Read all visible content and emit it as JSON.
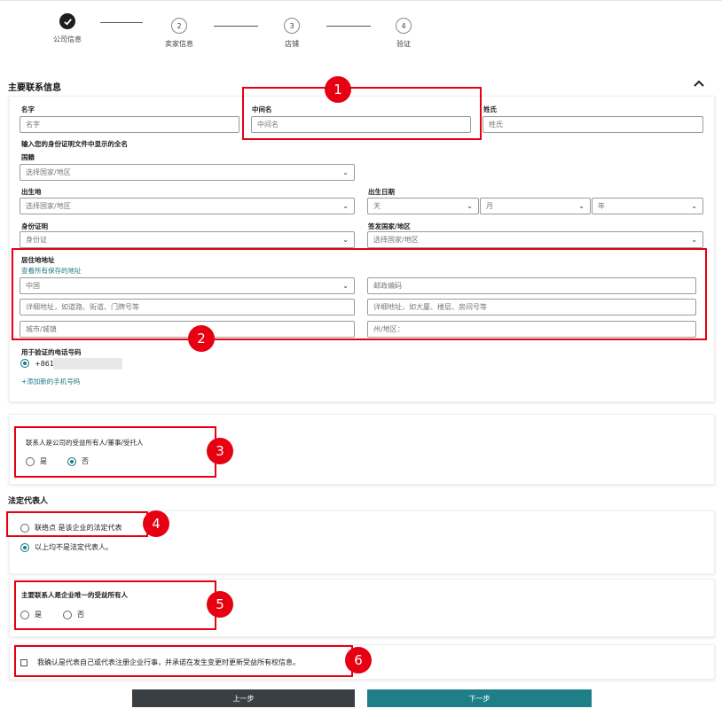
{
  "stepper": [
    {
      "num": "",
      "label": "公司信息",
      "done": true
    },
    {
      "num": "2",
      "label": "卖家信息",
      "done": false
    },
    {
      "num": "3",
      "label": "店铺",
      "done": false
    },
    {
      "num": "4",
      "label": "验证",
      "done": false
    }
  ],
  "primary_contact": {
    "title": "主要联系信息",
    "first_name": {
      "label": "名字",
      "placeholder": "名字"
    },
    "middle_name": {
      "label": "中间名",
      "placeholder": "中间名"
    },
    "last_name": {
      "label": "姓氏",
      "placeholder": "姓氏"
    },
    "fullname_hint": "输入您的身份证明文件中显示的全名",
    "nationality": {
      "label": "国籍",
      "value": "选择国家/地区"
    },
    "birthplace": {
      "label": "出生地",
      "value": "选择国家/地区"
    },
    "birthdate": {
      "label": "出生日期",
      "day": "天",
      "month": "月",
      "year": "年"
    },
    "id_proof": {
      "label": "身份证明",
      "value": "身份证"
    },
    "issuing_country": {
      "label": "签发国家/地区",
      "value": "选择国家/地区"
    },
    "address": {
      "label": "居住地地址",
      "saved_link": "查看所有保存的地址",
      "country": "中国",
      "postcode": "邮政编码",
      "line1": "详细地址，如道路、街道、门牌号等",
      "line2": "详细地址，如大厦、楼层、房间号等",
      "city": "城市/城镇",
      "state": "州/地区："
    },
    "phone": {
      "label": "用于验证的电话号码",
      "number": "+861",
      "add_link": "+添加新的手机号码"
    }
  },
  "beneficial_owner": {
    "question": "联系人是公司的受益所有人/董事/受托人",
    "yes": "是",
    "no": "否"
  },
  "legal_rep": {
    "title": "法定代表人",
    "option1": "联络点 是该企业的法定代表",
    "option2": "以上均不是法定代表人。"
  },
  "sole_owner": {
    "question": "主要联系人是企业唯一的受益所有人",
    "yes": "是",
    "no": "否"
  },
  "confirm": {
    "text": "我确认是代表自己或代表注册企业行事，并承诺在发生变更时更新受益所有权信息。"
  },
  "buttons": {
    "prev": "上一步",
    "next": "下一步"
  },
  "badges": [
    "1",
    "2",
    "3",
    "4",
    "5",
    "6"
  ],
  "colors": {
    "accent": "#1a7a83",
    "highlight": "#e60012",
    "prev_btn": "#3a3f44",
    "next_btn": "#1f7f88"
  }
}
